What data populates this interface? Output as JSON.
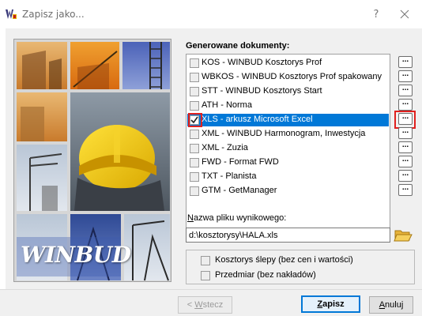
{
  "window": {
    "title": "Zapisz jako...",
    "help_label": "?"
  },
  "left_panel": {
    "logo_text": "WINBUD"
  },
  "documents": {
    "header": "Generowane dokumenty:",
    "items": [
      {
        "label": "KOS - WINBUD Kosztorys Prof",
        "checked": false,
        "selected": false
      },
      {
        "label": "WBKOS - WINBUD Kosztorys Prof spakowany",
        "checked": false,
        "selected": false
      },
      {
        "label": "STT - WINBUD Kosztorys Start",
        "checked": false,
        "selected": false
      },
      {
        "label": "ATH - Norma",
        "checked": false,
        "selected": false
      },
      {
        "label": "XLS - arkusz Microsoft Excel",
        "checked": true,
        "selected": true
      },
      {
        "label": "XML - WINBUD Harmonogram, Inwestycja",
        "checked": false,
        "selected": false
      },
      {
        "label": "XML - Zuzia",
        "checked": false,
        "selected": false
      },
      {
        "label": "FWD - Format FWD",
        "checked": false,
        "selected": false
      },
      {
        "label": "TXT - Planista",
        "checked": false,
        "selected": false
      },
      {
        "label": "GTM - GetManager",
        "checked": false,
        "selected": false
      }
    ],
    "dots_label": "..."
  },
  "output_file": {
    "label_first": "N",
    "label_rest": "azwa pliku wynikowego:",
    "value": "d:\\kosztorysy\\HALA.xls"
  },
  "options": {
    "blind_estimate": {
      "label": "Kosztorys ślepy (bez cen i wartości)",
      "checked": false
    },
    "bill_of_quantities": {
      "label": "Przedmiar (bez nakładów)",
      "checked": false
    }
  },
  "buttons": {
    "back_prefix": "< ",
    "back_first": "W",
    "back_rest": "stecz",
    "save_first": "Z",
    "save_rest": "apisz",
    "cancel_first": "A",
    "cancel_rest": "nuluj"
  },
  "colors": {
    "selection": "#0078d7",
    "highlight_box": "#e0201e",
    "dialog_bg": "#f0f0f0"
  }
}
